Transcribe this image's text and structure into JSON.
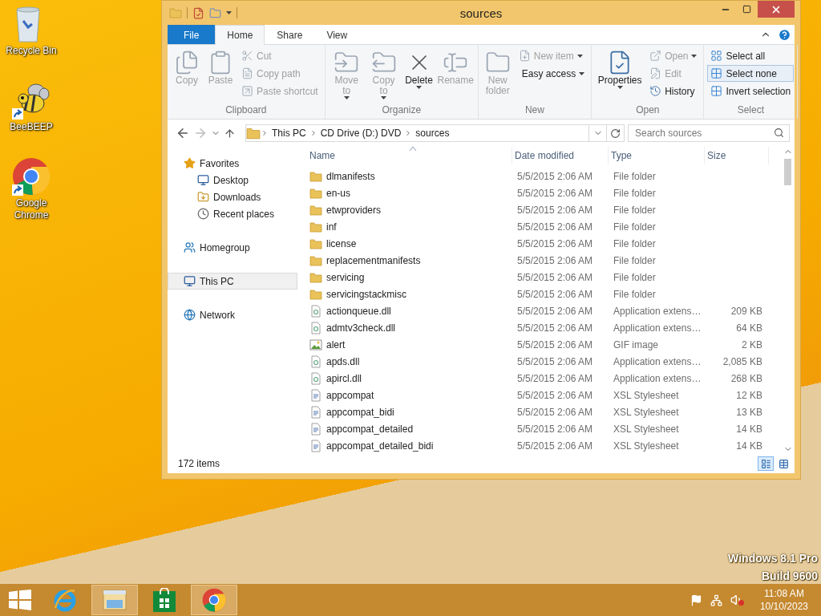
{
  "desktop": {
    "icons": [
      {
        "label": "Recycle Bin",
        "shortcut": false
      },
      {
        "label": "BeeBEEP",
        "shortcut": true
      },
      {
        "label": "Google Chrome",
        "shortcut": true
      }
    ],
    "watermark": [
      "Windows 8.1 Pro",
      "Build 9600"
    ]
  },
  "window": {
    "title": "sources",
    "ribbon_tabs": [
      {
        "label": "File",
        "kind": "file",
        "selected": false
      },
      {
        "label": "Home",
        "kind": "tab",
        "selected": true
      },
      {
        "label": "Share",
        "kind": "tab",
        "selected": false
      },
      {
        "label": "View",
        "kind": "tab",
        "selected": false
      }
    ],
    "ribbon": [
      {
        "label": "Clipboard",
        "items": [
          {
            "label": "Copy",
            "kind": "large",
            "disabled": true,
            "dropdown": false,
            "hovered": false
          },
          {
            "label": "Paste",
            "kind": "large",
            "disabled": true,
            "dropdown": false,
            "hovered": false
          },
          {
            "label": "Cut",
            "kind": "small",
            "disabled": true,
            "dropdown": false,
            "hovered": false
          },
          {
            "label": "Copy path",
            "kind": "small",
            "disabled": true,
            "dropdown": false,
            "hovered": false
          },
          {
            "label": "Paste shortcut",
            "kind": "small",
            "disabled": true,
            "dropdown": false,
            "hovered": false
          }
        ]
      },
      {
        "label": "Organize",
        "items": [
          {
            "label": "Move to",
            "kind": "large",
            "disabled": true,
            "dropdown": true,
            "hovered": false
          },
          {
            "label": "Copy to",
            "kind": "large",
            "disabled": true,
            "dropdown": true,
            "hovered": false
          },
          {
            "label": "Delete",
            "kind": "large",
            "disabled": false,
            "dropdown": true,
            "hovered": false
          },
          {
            "label": "Rename",
            "kind": "large",
            "disabled": true,
            "dropdown": false,
            "hovered": false
          }
        ]
      },
      {
        "label": "New",
        "items": [
          {
            "label": "New folder",
            "kind": "large",
            "disabled": true,
            "dropdown": false,
            "hovered": false
          },
          {
            "label": "New item",
            "kind": "small",
            "disabled": true,
            "dropdown": true,
            "hovered": false
          },
          {
            "label": "Easy access",
            "kind": "small",
            "disabled": false,
            "dropdown": true,
            "hovered": false
          }
        ]
      },
      {
        "label": "Open",
        "items": [
          {
            "label": "Properties",
            "kind": "large",
            "disabled": false,
            "dropdown": true,
            "hovered": false
          },
          {
            "label": "Open",
            "kind": "small",
            "disabled": true,
            "dropdown": true,
            "hovered": false
          },
          {
            "label": "Edit",
            "kind": "small",
            "disabled": true,
            "dropdown": false,
            "hovered": false
          },
          {
            "label": "History",
            "kind": "small",
            "disabled": false,
            "dropdown": false,
            "hovered": false
          }
        ]
      },
      {
        "label": "Select",
        "items": [
          {
            "label": "Select all",
            "kind": "small",
            "disabled": false,
            "dropdown": false,
            "hovered": false
          },
          {
            "label": "Select none",
            "kind": "small",
            "disabled": false,
            "dropdown": false,
            "hovered": true
          },
          {
            "label": "Invert selection",
            "kind": "small",
            "disabled": false,
            "dropdown": false,
            "hovered": false
          }
        ]
      }
    ],
    "path": [
      "This PC",
      "CD Drive (D:) DVD",
      "sources"
    ],
    "search": {
      "placeholder": "Search sources"
    },
    "nav": [
      {
        "label": "Favorites",
        "selected": false,
        "children": [
          {
            "label": "Desktop",
            "selected": false
          },
          {
            "label": "Downloads",
            "selected": false
          },
          {
            "label": "Recent places",
            "selected": false
          }
        ]
      },
      {
        "label": "Homegroup",
        "selected": false
      },
      {
        "label": "This PC",
        "selected": true
      },
      {
        "label": "Network",
        "selected": false
      }
    ],
    "columns": [
      {
        "label": "Name",
        "sorted": true
      },
      {
        "label": "Date modified",
        "sorted": false
      },
      {
        "label": "Type",
        "sorted": false
      },
      {
        "label": "Size",
        "sorted": false
      }
    ],
    "rows": [
      {
        "kind": "folder",
        "name": "dlmanifests",
        "date": "5/5/2015 2:06 AM",
        "type": "File folder"
      },
      {
        "kind": "folder",
        "name": "en-us",
        "date": "5/5/2015 2:06 AM",
        "type": "File folder"
      },
      {
        "kind": "folder",
        "name": "etwproviders",
        "date": "5/5/2015 2:06 AM",
        "type": "File folder"
      },
      {
        "kind": "folder",
        "name": "inf",
        "date": "5/5/2015 2:06 AM",
        "type": "File folder"
      },
      {
        "kind": "folder",
        "name": "license",
        "date": "5/5/2015 2:06 AM",
        "type": "File folder"
      },
      {
        "kind": "folder",
        "name": "replacementmanifests",
        "date": "5/5/2015 2:06 AM",
        "type": "File folder"
      },
      {
        "kind": "folder",
        "name": "servicing",
        "date": "5/5/2015 2:06 AM",
        "type": "File folder"
      },
      {
        "kind": "folder",
        "name": "servicingstackmisc",
        "date": "5/5/2015 2:06 AM",
        "type": "File folder"
      },
      {
        "kind": "dll",
        "name": "actionqueue.dll",
        "date": "5/5/2015 2:06 AM",
        "type": "Application extens…",
        "size": "209 KB"
      },
      {
        "kind": "dll",
        "name": "admtv3check.dll",
        "date": "5/5/2015 2:06 AM",
        "type": "Application extens…",
        "size": "64 KB"
      },
      {
        "kind": "gif",
        "name": "alert",
        "date": "5/5/2015 2:06 AM",
        "type": "GIF image",
        "size": "2 KB"
      },
      {
        "kind": "dll",
        "name": "apds.dll",
        "date": "5/5/2015 2:06 AM",
        "type": "Application extens…",
        "size": "2,085 KB"
      },
      {
        "kind": "dll",
        "name": "apircl.dll",
        "date": "5/5/2015 2:06 AM",
        "type": "Application extens…",
        "size": "268 KB"
      },
      {
        "kind": "xsl",
        "name": "appcompat",
        "date": "5/5/2015 2:06 AM",
        "type": "XSL Stylesheet",
        "size": "12 KB"
      },
      {
        "kind": "xsl",
        "name": "appcompat_bidi",
        "date": "5/5/2015 2:06 AM",
        "type": "XSL Stylesheet",
        "size": "13 KB"
      },
      {
        "kind": "xsl",
        "name": "appcompat_detailed",
        "date": "5/5/2015 2:06 AM",
        "type": "XSL Stylesheet",
        "size": "14 KB"
      },
      {
        "kind": "xsl",
        "name": "appcompat_detailed_bidi",
        "date": "5/5/2015 2:06 AM",
        "type": "XSL Stylesheet",
        "size": "14 KB"
      }
    ],
    "status_bar": {
      "count": "172 items",
      "views": [
        {
          "selected": true
        },
        {
          "selected": false
        }
      ]
    }
  },
  "taskbar": {
    "apps": [
      {
        "running": false
      },
      {
        "running": true
      },
      {
        "running": false
      },
      {
        "running": true
      }
    ],
    "time": "11:08 AM",
    "date": "10/10/2023"
  }
}
